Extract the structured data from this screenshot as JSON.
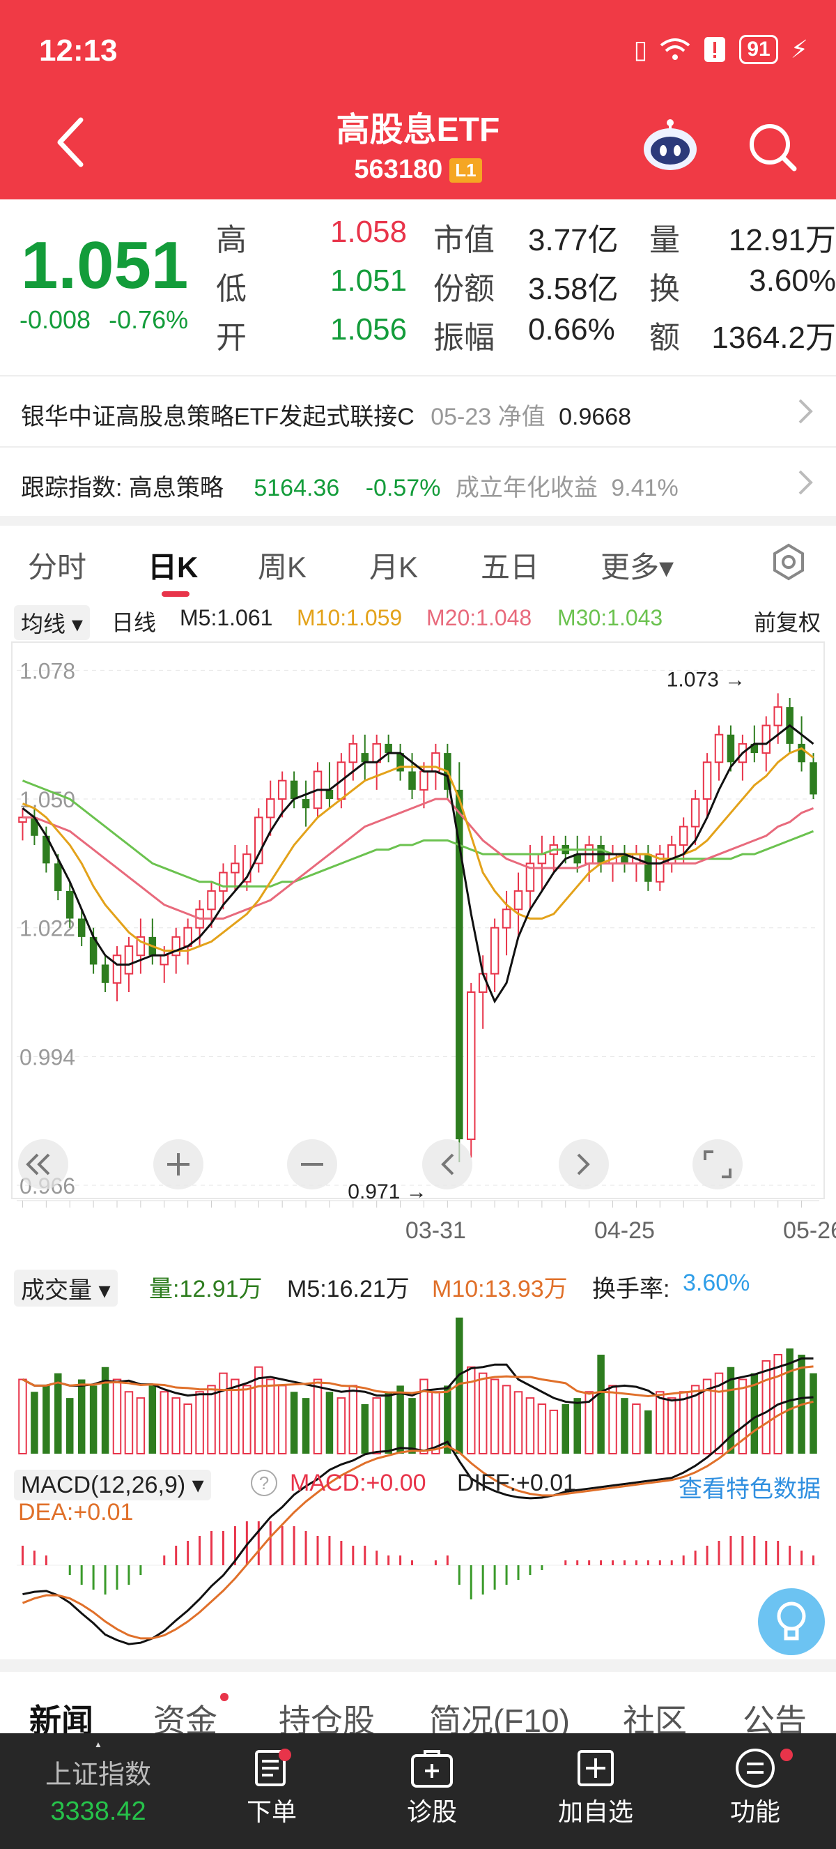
{
  "status": {
    "time": "12:13",
    "battery": "91"
  },
  "header": {
    "title": "高股息ETF",
    "code": "563180",
    "level": "L1"
  },
  "quote": {
    "price": "1.051",
    "change": "-0.008",
    "change_pct": "-0.76%",
    "rows": [
      {
        "l1": "高",
        "v1": "1.058",
        "l2": "市值",
        "v2": "3.77亿",
        "l3": "量",
        "v3": "12.91万"
      },
      {
        "l1": "低",
        "v1": "1.051",
        "l2": "份额",
        "v2": "3.58亿",
        "l3": "换",
        "v3": "3.60%"
      },
      {
        "l1": "开",
        "v1": "1.056",
        "l2": "振幅",
        "v2": "0.66%",
        "l3": "额",
        "v3": "1364.2万"
      }
    ]
  },
  "linked_fund": {
    "name": "银华中证高股息策略ETF发起式联接C",
    "date_label": "05-23 净值",
    "nav": "0.9668"
  },
  "tracking": {
    "label": "跟踪指数: 高息策略",
    "value": "5164.36",
    "pct": "-0.57%",
    "annual_label": "成立年化收益",
    "annual": "9.41%"
  },
  "tabs": [
    "分时",
    "日K",
    "周K",
    "月K",
    "五日",
    "更多▾"
  ],
  "ma": {
    "selector": "均线 ▾",
    "period": "日线",
    "m5": "M5:1.061",
    "m10": "M10:1.059",
    "m20": "M20:1.048",
    "m30": "M30:1.043",
    "adjust": "前复权"
  },
  "colors": {
    "up": "#e8344a",
    "down": "#2e7d1f",
    "m5": "#111111",
    "m10": "#e3a21a",
    "m20": "#e86a7c",
    "m30": "#6bc24f",
    "header": "#f03a45"
  },
  "chart_data": {
    "type": "candlestick",
    "ylim": [
      0.966,
      1.082
    ],
    "y_ticks": [
      "1.078",
      "1.050",
      "1.022",
      "0.994",
      "0.966"
    ],
    "x_ticks": [
      "03-31",
      "04-25",
      "05-26"
    ],
    "high_label": "1.073",
    "low_label": "0.971",
    "candles": [
      [
        1.045,
        1.048,
        1.041,
        1.046
      ],
      [
        1.046,
        1.048,
        1.04,
        1.042
      ],
      [
        1.042,
        1.044,
        1.034,
        1.036
      ],
      [
        1.036,
        1.038,
        1.028,
        1.03
      ],
      [
        1.03,
        1.032,
        1.022,
        1.024
      ],
      [
        1.024,
        1.026,
        1.018,
        1.02
      ],
      [
        1.02,
        1.022,
        1.012,
        1.014
      ],
      [
        1.014,
        1.016,
        1.008,
        1.01
      ],
      [
        1.01,
        1.018,
        1.006,
        1.016
      ],
      [
        1.012,
        1.02,
        1.008,
        1.018
      ],
      [
        1.016,
        1.024,
        1.012,
        1.02
      ],
      [
        1.02,
        1.024,
        1.014,
        1.016
      ],
      [
        1.014,
        1.018,
        1.01,
        1.016
      ],
      [
        1.016,
        1.022,
        1.012,
        1.02
      ],
      [
        1.018,
        1.024,
        1.014,
        1.022
      ],
      [
        1.022,
        1.028,
        1.018,
        1.026
      ],
      [
        1.026,
        1.032,
        1.022,
        1.03
      ],
      [
        1.03,
        1.036,
        1.026,
        1.034
      ],
      [
        1.034,
        1.04,
        1.03,
        1.036
      ],
      [
        1.032,
        1.04,
        1.03,
        1.038
      ],
      [
        1.036,
        1.048,
        1.034,
        1.046
      ],
      [
        1.046,
        1.054,
        1.042,
        1.05
      ],
      [
        1.05,
        1.056,
        1.046,
        1.054
      ],
      [
        1.054,
        1.056,
        1.048,
        1.05
      ],
      [
        1.05,
        1.054,
        1.044,
        1.048
      ],
      [
        1.048,
        1.058,
        1.046,
        1.056
      ],
      [
        1.052,
        1.058,
        1.048,
        1.05
      ],
      [
        1.05,
        1.06,
        1.048,
        1.058
      ],
      [
        1.058,
        1.064,
        1.054,
        1.062
      ],
      [
        1.06,
        1.064,
        1.054,
        1.058
      ],
      [
        1.058,
        1.064,
        1.052,
        1.062
      ],
      [
        1.062,
        1.064,
        1.058,
        1.06
      ],
      [
        1.06,
        1.062,
        1.054,
        1.056
      ],
      [
        1.056,
        1.06,
        1.05,
        1.052
      ],
      [
        1.052,
        1.058,
        1.048,
        1.056
      ],
      [
        1.056,
        1.062,
        1.052,
        1.06
      ],
      [
        1.06,
        1.062,
        1.05,
        1.052
      ],
      [
        1.052,
        1.058,
        0.971,
        0.976
      ],
      [
        0.976,
        1.01,
        0.972,
        1.008
      ],
      [
        1.008,
        1.016,
        1.0,
        1.012
      ],
      [
        1.012,
        1.024,
        1.008,
        1.022
      ],
      [
        1.022,
        1.03,
        1.016,
        1.026
      ],
      [
        1.026,
        1.034,
        1.02,
        1.03
      ],
      [
        1.03,
        1.04,
        1.026,
        1.036
      ],
      [
        1.036,
        1.042,
        1.03,
        1.038
      ],
      [
        1.038,
        1.042,
        1.034,
        1.04
      ],
      [
        1.04,
        1.042,
        1.036,
        1.038
      ],
      [
        1.038,
        1.042,
        1.034,
        1.036
      ],
      [
        1.036,
        1.042,
        1.032,
        1.04
      ],
      [
        1.04,
        1.042,
        1.034,
        1.036
      ],
      [
        1.036,
        1.04,
        1.032,
        1.038
      ],
      [
        1.038,
        1.04,
        1.034,
        1.036
      ],
      [
        1.036,
        1.04,
        1.032,
        1.038
      ],
      [
        1.038,
        1.04,
        1.03,
        1.032
      ],
      [
        1.032,
        1.04,
        1.03,
        1.038
      ],
      [
        1.036,
        1.042,
        1.034,
        1.04
      ],
      [
        1.04,
        1.046,
        1.036,
        1.044
      ],
      [
        1.044,
        1.052,
        1.04,
        1.05
      ],
      [
        1.05,
        1.06,
        1.046,
        1.058
      ],
      [
        1.058,
        1.066,
        1.054,
        1.064
      ],
      [
        1.064,
        1.066,
        1.056,
        1.058
      ],
      [
        1.058,
        1.064,
        1.054,
        1.062
      ],
      [
        1.062,
        1.066,
        1.058,
        1.06
      ],
      [
        1.06,
        1.068,
        1.056,
        1.066
      ],
      [
        1.066,
        1.073,
        1.062,
        1.07
      ],
      [
        1.07,
        1.072,
        1.06,
        1.062
      ],
      [
        1.062,
        1.068,
        1.056,
        1.058
      ],
      [
        1.058,
        1.06,
        1.05,
        1.051
      ]
    ],
    "ma5": [
      1.048,
      1.046,
      1.042,
      1.037,
      1.032,
      1.026,
      1.02,
      1.016,
      1.014,
      1.014,
      1.015,
      1.016,
      1.016,
      1.017,
      1.018,
      1.02,
      1.023,
      1.027,
      1.03,
      1.033,
      1.038,
      1.043,
      1.047,
      1.05,
      1.051,
      1.052,
      1.052,
      1.054,
      1.056,
      1.058,
      1.058,
      1.06,
      1.06,
      1.058,
      1.056,
      1.056,
      1.055,
      1.04,
      1.025,
      1.012,
      1.006,
      1.01,
      1.02,
      1.026,
      1.03,
      1.034,
      1.037,
      1.038,
      1.038,
      1.038,
      1.038,
      1.038,
      1.037,
      1.036,
      1.036,
      1.037,
      1.038,
      1.041,
      1.046,
      1.052,
      1.057,
      1.06,
      1.062,
      1.062,
      1.064,
      1.066,
      1.064,
      1.062
    ],
    "ma10": [
      1.049,
      1.048,
      1.046,
      1.043,
      1.04,
      1.036,
      1.031,
      1.027,
      1.024,
      1.021,
      1.019,
      1.018,
      1.017,
      1.017,
      1.017,
      1.018,
      1.019,
      1.021,
      1.023,
      1.025,
      1.028,
      1.032,
      1.036,
      1.04,
      1.043,
      1.046,
      1.048,
      1.05,
      1.052,
      1.054,
      1.055,
      1.056,
      1.057,
      1.057,
      1.057,
      1.057,
      1.056,
      1.05,
      1.042,
      1.034,
      1.03,
      1.027,
      1.025,
      1.024,
      1.024,
      1.025,
      1.028,
      1.031,
      1.034,
      1.036,
      1.037,
      1.038,
      1.038,
      1.038,
      1.037,
      1.037,
      1.038,
      1.039,
      1.041,
      1.044,
      1.047,
      1.05,
      1.053,
      1.055,
      1.058,
      1.06,
      1.061,
      1.059
    ],
    "ma20": [
      1.046,
      1.046,
      1.045,
      1.044,
      1.043,
      1.041,
      1.039,
      1.037,
      1.035,
      1.033,
      1.031,
      1.029,
      1.027,
      1.026,
      1.025,
      1.024,
      1.024,
      1.024,
      1.025,
      1.026,
      1.027,
      1.028,
      1.03,
      1.032,
      1.034,
      1.036,
      1.038,
      1.04,
      1.042,
      1.044,
      1.045,
      1.046,
      1.047,
      1.048,
      1.049,
      1.05,
      1.05,
      1.047,
      1.044,
      1.041,
      1.039,
      1.037,
      1.036,
      1.035,
      1.035,
      1.035,
      1.035,
      1.035,
      1.036,
      1.036,
      1.036,
      1.036,
      1.036,
      1.036,
      1.036,
      1.036,
      1.036,
      1.036,
      1.037,
      1.038,
      1.039,
      1.04,
      1.041,
      1.042,
      1.044,
      1.045,
      1.047,
      1.048
    ],
    "ma30": [
      1.054,
      1.053,
      1.052,
      1.051,
      1.05,
      1.048,
      1.046,
      1.044,
      1.042,
      1.04,
      1.038,
      1.036,
      1.035,
      1.034,
      1.033,
      1.032,
      1.032,
      1.031,
      1.031,
      1.031,
      1.031,
      1.031,
      1.032,
      1.032,
      1.033,
      1.034,
      1.035,
      1.036,
      1.037,
      1.038,
      1.039,
      1.039,
      1.04,
      1.04,
      1.041,
      1.041,
      1.041,
      1.04,
      1.039,
      1.038,
      1.038,
      1.038,
      1.038,
      1.038,
      1.038,
      1.039,
      1.039,
      1.039,
      1.039,
      1.039,
      1.038,
      1.038,
      1.038,
      1.038,
      1.037,
      1.037,
      1.037,
      1.037,
      1.037,
      1.037,
      1.037,
      1.038,
      1.038,
      1.039,
      1.04,
      1.041,
      1.042,
      1.043
    ],
    "volume": [
      12,
      10,
      11,
      13,
      9,
      12,
      11,
      14,
      12,
      10,
      9,
      11,
      10,
      9,
      8,
      10,
      11,
      13,
      12,
      11,
      14,
      12,
      11,
      10,
      9,
      12,
      10,
      9,
      11,
      8,
      9,
      10,
      11,
      9,
      12,
      10,
      11,
      22,
      14,
      13,
      12,
      11,
      10,
      9,
      8,
      7,
      8,
      9,
      10,
      16,
      11,
      9,
      8,
      7,
      10,
      9,
      10,
      11,
      12,
      13,
      14,
      12,
      13,
      15,
      16,
      17,
      16,
      13
    ],
    "macd_hist": [
      0.004,
      0.003,
      0.002,
      0.0,
      -0.002,
      -0.004,
      -0.005,
      -0.006,
      -0.005,
      -0.004,
      -0.002,
      0.0,
      0.002,
      0.004,
      0.005,
      0.006,
      0.007,
      0.007,
      0.008,
      0.009,
      0.009,
      0.009,
      0.008,
      0.008,
      0.007,
      0.006,
      0.006,
      0.005,
      0.004,
      0.004,
      0.003,
      0.002,
      0.002,
      0.001,
      0.0,
      0.001,
      0.002,
      -0.004,
      -0.007,
      -0.006,
      -0.005,
      -0.004,
      -0.003,
      -0.002,
      -0.001,
      0.0,
      0.001,
      0.001,
      0.001,
      0.001,
      0.001,
      0.001,
      0.001,
      0.001,
      0.001,
      0.001,
      0.002,
      0.003,
      0.004,
      0.005,
      0.006,
      0.006,
      0.006,
      0.005,
      0.005,
      0.004,
      0.003,
      0.002
    ]
  },
  "volume_panel": {
    "selector": "成交量 ▾",
    "vol": "量:12.91万",
    "m5": "M5:16.21万",
    "m10": "M10:13.93万",
    "turnover_label": "换手率:",
    "turnover": "3.60%"
  },
  "macd_panel": {
    "selector": "MACD(12,26,9) ▾",
    "help": "?",
    "macd": "MACD:+0.00",
    "diff": "DIFF:+0.01",
    "dea": "DEA:+0.01",
    "link": "查看特色数据"
  },
  "news_tabs": [
    "新闻",
    "资金",
    "持仓股",
    "简况(F10)",
    "社区",
    "公告"
  ],
  "bottom": {
    "index_name": "上证指数",
    "index_value": "3338.42",
    "items": [
      "下单",
      "诊股",
      "加自选",
      "功能"
    ]
  }
}
